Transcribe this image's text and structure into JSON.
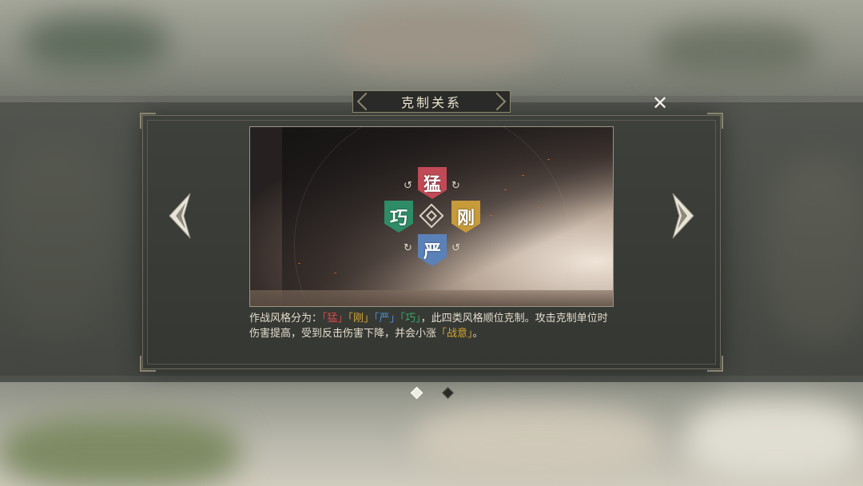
{
  "dialog": {
    "title": "克制关系",
    "close_icon": "close-x-icon"
  },
  "emblem": {
    "styles": [
      {
        "char": "猛",
        "color": "#c04a56"
      },
      {
        "char": "刚",
        "color": "#c79a3a"
      },
      {
        "char": "严",
        "color": "#5b82b8"
      },
      {
        "char": "巧",
        "color": "#2e8c66"
      }
    ]
  },
  "description": {
    "intro": "作战风格分为：",
    "q1": "「猛」",
    "q2": "「刚」",
    "q3": "「严」",
    "q4": "「巧」",
    "rest": "，此四类风格顺位克制。攻击克制单位时伤害提高，受到反击伤害下降，并会小涨",
    "keyword": "「战意」",
    "end": "。"
  },
  "pager": {
    "pages": 2,
    "current": 1
  },
  "colors": {
    "meng": "#d24b4b",
    "gang": "#d3a532",
    "yan": "#4f8fd0",
    "qiao": "#3aa86a"
  }
}
